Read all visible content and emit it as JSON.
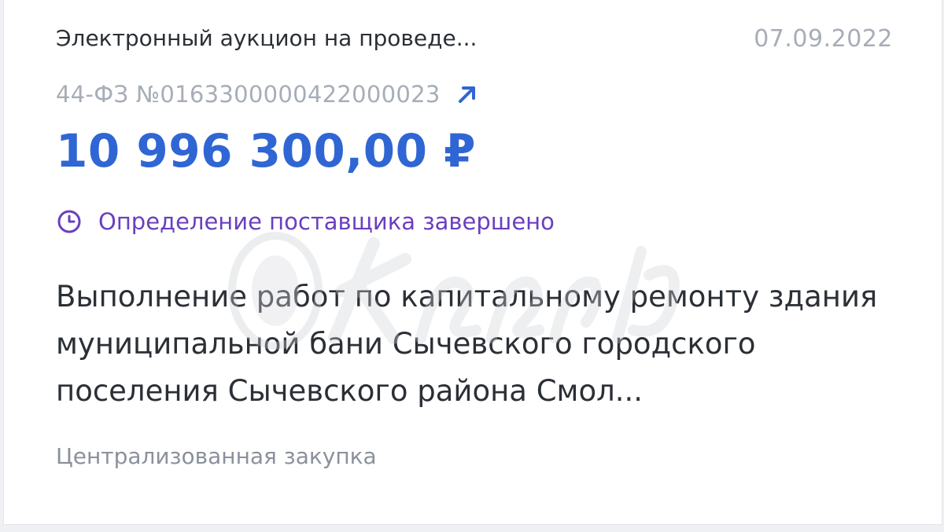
{
  "card": {
    "procedure_type": "Электронный аукцион на проведе...",
    "date": "07.09.2022",
    "registry_number": "44-ФЗ №0163300000422000023",
    "price": "10 996 300,00 ₽",
    "status": "Определение поставщика завершено",
    "subject": "Выполнение работ по капитальному ремонту здания муниципальной бани Сычевского городского поселения Сычевского района Смол...",
    "purchase_kind": "Централизованная закупка"
  },
  "icons": {
    "link": "arrow-up-right-icon",
    "status": "clock-icon"
  },
  "colors": {
    "accent_blue": "#2f66d4",
    "status_purple": "#6a3fbf",
    "muted_gray": "#a7adb8",
    "text_dark": "#2b2f36"
  }
}
